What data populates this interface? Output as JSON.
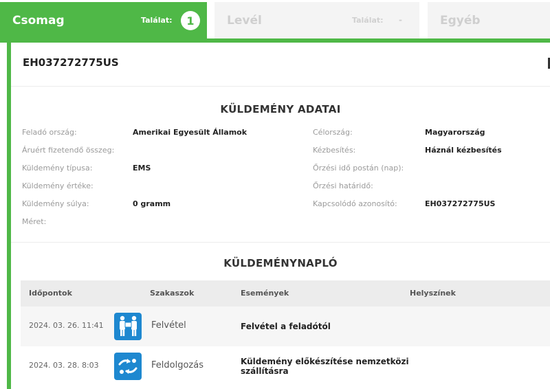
{
  "tabs": [
    {
      "title": "Csomag",
      "count_label": "Találat:",
      "count": "1",
      "active": true
    },
    {
      "title": "Levél",
      "count_label": "Találat:",
      "count": "-",
      "active": false
    },
    {
      "title": "Egyéb",
      "count_label": "",
      "count": "",
      "active": false
    }
  ],
  "shipment": {
    "tracking_id": "EH037272775US",
    "section_title": "KÜLDEMÉNY ADATAI",
    "left_fields": [
      {
        "label": "Feladó ország:",
        "value": "Amerikai Egyesült Államok"
      },
      {
        "label": "Áruért fizetendő összeg:",
        "value": ""
      },
      {
        "label": "Küldemény típusa:",
        "value": "EMS"
      },
      {
        "label": "Küldemény értéke:",
        "value": ""
      },
      {
        "label": "Küldemény súlya:",
        "value": "0 gramm"
      },
      {
        "label": "Méret:",
        "value": ""
      }
    ],
    "right_fields": [
      {
        "label": "Célország:",
        "value": "Magyarország"
      },
      {
        "label": "Kézbesítés:",
        "value": "Háznál kézbesítés"
      },
      {
        "label": "Őrzési idő postán (nap):",
        "value": ""
      },
      {
        "label": "Őrzési határidő:",
        "value": ""
      },
      {
        "label": "Kapcsolódó azonosító:",
        "value": "EH037272775US"
      }
    ]
  },
  "log": {
    "section_title": "KÜLDEMÉNYNAPLÓ",
    "columns": [
      "Időpontok",
      "Szakaszok",
      "Események",
      "Helyszínek"
    ],
    "rows": [
      {
        "time": "2024. 03. 26. 11:41",
        "stage": "Felvétel",
        "stage_icon": "handover-icon",
        "event": "Felvétel a feladótól",
        "location": ""
      },
      {
        "time": "2024. 03. 28. 8:03",
        "stage": "Feldolgozás",
        "stage_icon": "processing-icon",
        "event": "Küldemény előkészítése nemzetközi szállításra",
        "location": ""
      }
    ]
  },
  "colors": {
    "accent": "#4fb847",
    "icon_bg": "#1e88d0"
  }
}
